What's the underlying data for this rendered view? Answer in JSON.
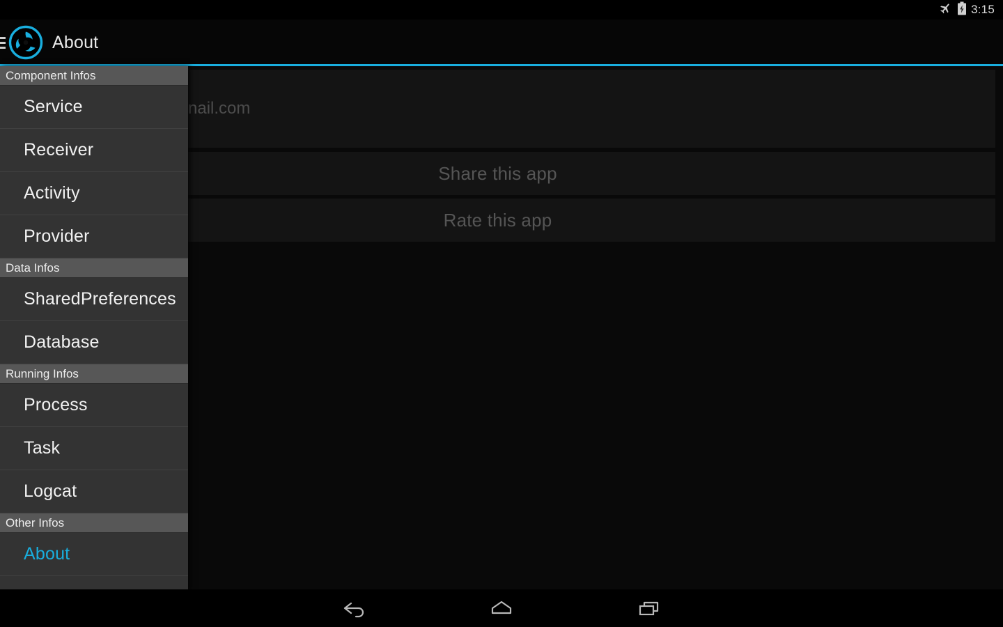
{
  "status_bar": {
    "time": "3:15",
    "icons": [
      "airplane-mode-icon",
      "battery-charging-icon"
    ]
  },
  "action_bar": {
    "menu_icon": "hamburger-menu-icon",
    "logo_icon": "app-logo-pinwheel-icon",
    "title": "About",
    "accent_color": "#19aede"
  },
  "drawer": {
    "sections": [
      {
        "header": "Component Infos",
        "items": [
          {
            "label": "Service",
            "selected": false
          },
          {
            "label": "Receiver",
            "selected": false
          },
          {
            "label": "Activity",
            "selected": false
          },
          {
            "label": "Provider",
            "selected": false
          }
        ]
      },
      {
        "header": "Data Infos",
        "items": [
          {
            "label": "SharedPreferences",
            "selected": false
          },
          {
            "label": "Database",
            "selected": false
          }
        ]
      },
      {
        "header": "Running Infos",
        "items": [
          {
            "label": "Process",
            "selected": false
          },
          {
            "label": "Task",
            "selected": false
          },
          {
            "label": "Logcat",
            "selected": false
          }
        ]
      },
      {
        "header": "Other Infos",
        "items": [
          {
            "label": "About",
            "selected": true
          }
        ]
      }
    ]
  },
  "content": {
    "email_partial": "nail.com",
    "share_label": "Share this app",
    "rate_label": "Rate this app"
  },
  "nav_bar": {
    "back_label": "back-icon",
    "home_label": "home-icon",
    "recents_label": "recents-icon"
  }
}
